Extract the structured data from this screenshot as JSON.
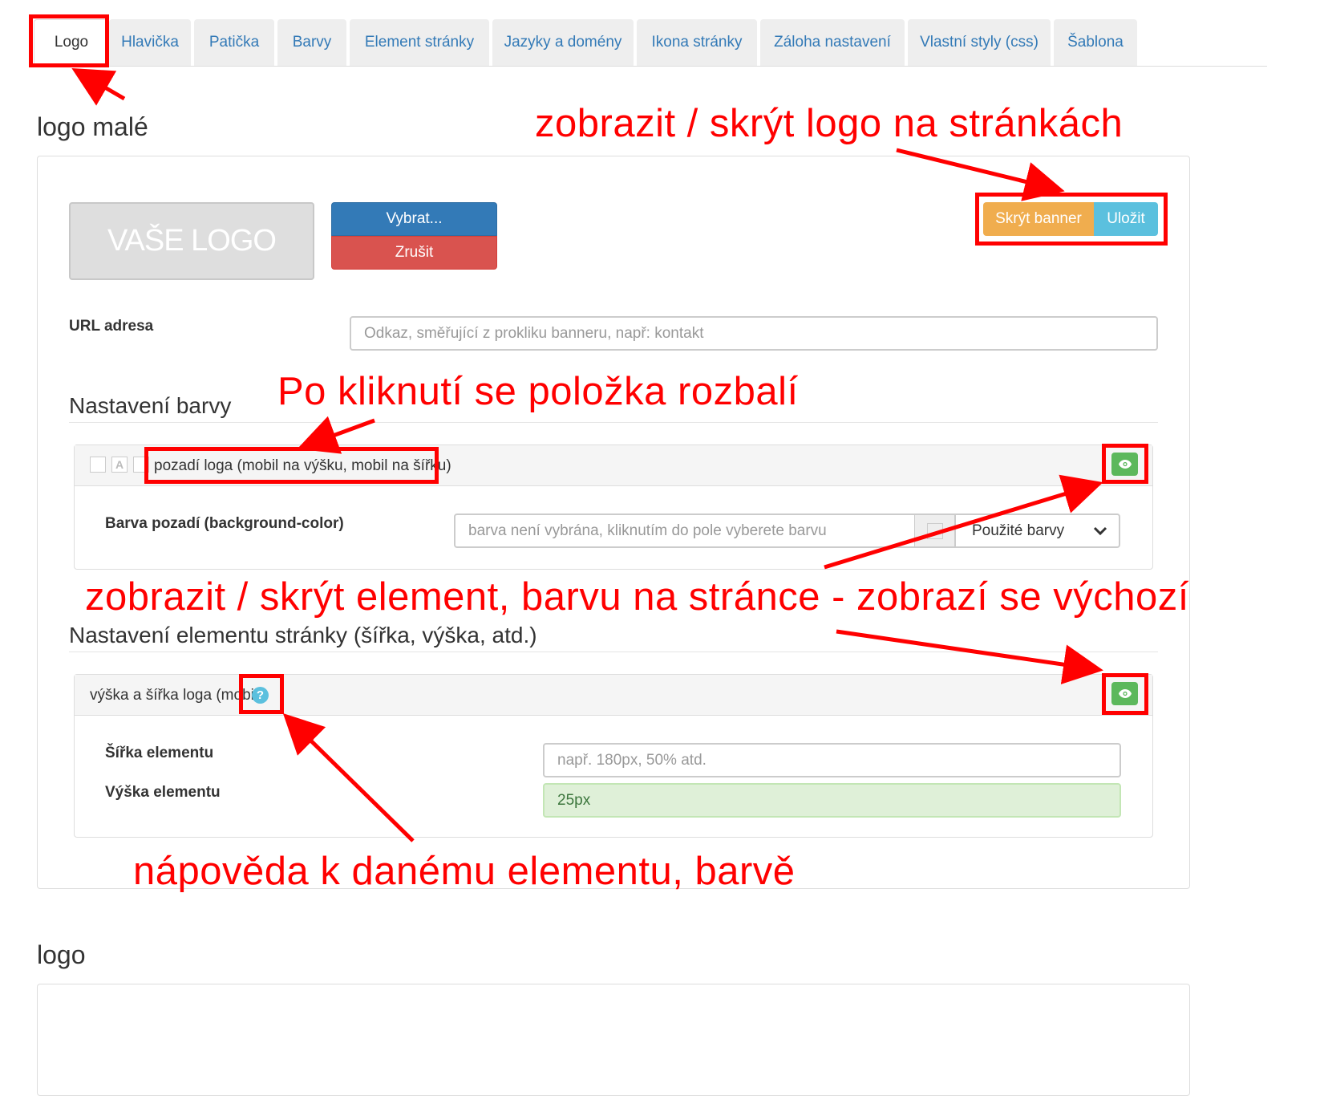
{
  "tabs": [
    {
      "label": "Logo",
      "active": true
    },
    {
      "label": "Hlavička"
    },
    {
      "label": "Patička"
    },
    {
      "label": "Barvy"
    },
    {
      "label": "Element stránky"
    },
    {
      "label": "Jazyky a domény"
    },
    {
      "label": "Ikona stránky"
    },
    {
      "label": "Záloha nastavení"
    },
    {
      "label": "Vlastní styly (css)"
    },
    {
      "label": "Šablona"
    }
  ],
  "logo_small": {
    "title": "logo malé",
    "placeholder_text": "VAŠE LOGO",
    "select_button": "Vybrat...",
    "cancel_button": "Zrušit",
    "hide_banner_button": "Skrýt banner",
    "save_button": "Uložit",
    "url_label": "URL adresa",
    "url_placeholder": "Odkaz, směřující z prokliku banneru, např: kontakt",
    "color_settings": {
      "heading": "Nastavení barvy",
      "item_title": "pozadí loga (mobil na výšku, mobil na šířku)",
      "mini_box_letter": "A",
      "field_label": "Barva pozadí (background-color)",
      "field_placeholder": "barva není vybrána, kliknutím do pole vyberete barvu",
      "select_value": "Použité barvy"
    },
    "element_settings": {
      "heading": "Nastavení elementu stránky (šířka, výška, atd.)",
      "item_title": "výška a šířka loga (mobil)",
      "help_glyph": "?",
      "width_label": "Šířka elementu",
      "width_placeholder": "např. 180px, 50% atd.",
      "height_label": "Výška elementu",
      "height_value": "25px"
    }
  },
  "logo": {
    "title": "logo"
  },
  "annotations": {
    "show_hide_logo": "zobrazit / skrýt logo na stránkách",
    "click_expand": "Po kliknutí se položka rozbalí",
    "show_hide_element": "zobrazit / skrýt element, barvu na stránce - zobrazí se výchozí",
    "help": "nápověda k danému elementu, barvě"
  },
  "colors": {
    "primary": "#337ab7",
    "danger": "#d9534f",
    "warning": "#f0ad4e",
    "info": "#5bc0de",
    "success": "#5cb85c",
    "annotation": "#ff0000"
  }
}
